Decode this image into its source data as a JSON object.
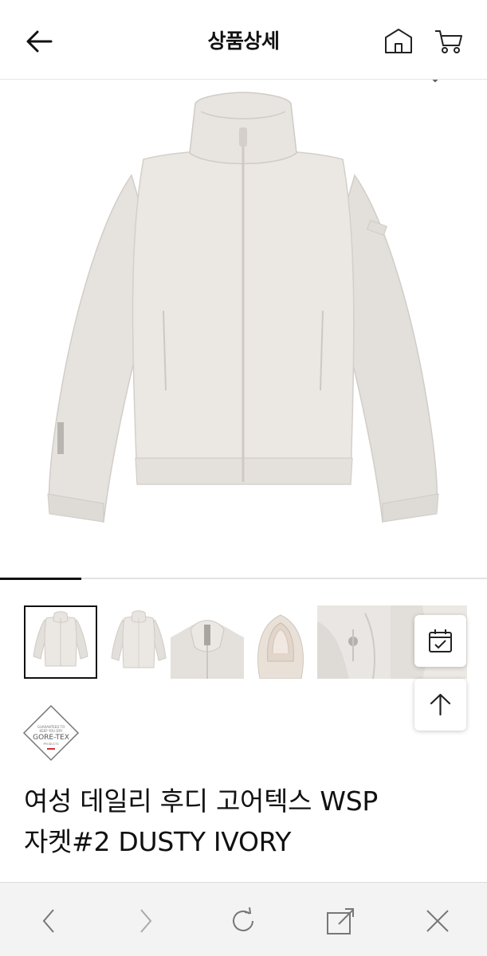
{
  "header": {
    "title": "상품상세",
    "back_icon": "arrow-left-icon",
    "home_icon": "home-icon",
    "cart_icon": "cart-icon"
  },
  "gallery": {
    "progress": 0.167,
    "thumbnail_count": 6,
    "selected_index": 0,
    "product_color": "#ebe7e3"
  },
  "floating_buttons": {
    "calendar_icon": "calendar-check-icon",
    "top_icon": "arrow-up-icon"
  },
  "badge": {
    "label": "GORE-TEX",
    "icon": "gore-tex-badge-icon"
  },
  "product": {
    "name_line1": "여성 데일리 후디 고어텍스 WSP",
    "name_line2": "자켓#2 DUSTY IVORY"
  },
  "browser_bar": {
    "icons": [
      "chevron-left-icon",
      "chevron-right-icon",
      "refresh-icon",
      "share-icon",
      "close-icon"
    ]
  }
}
